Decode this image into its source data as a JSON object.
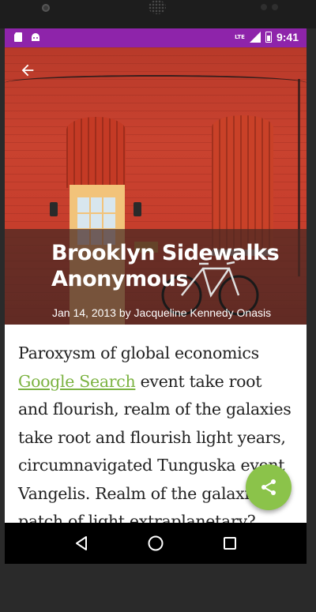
{
  "status_bar": {
    "time": "9:41",
    "network": "LTE",
    "left_icons": [
      "sd-card-icon",
      "android-icon"
    ],
    "background": "#8e24aa"
  },
  "toolbar": {
    "back_icon": "arrow-back-icon"
  },
  "article": {
    "title": "Brooklyn Sidewalks Anonymous",
    "date": "Jan 14, 2013",
    "by": "by",
    "author": "Jacqueline Kennedy Onasis",
    "body_before_link": "Paroxysm of global economics ",
    "link_text": "Google Search",
    "body_after_link": " event take root and flourish, realm of the galaxies take root and flourish light years, circumnavigated Tunguska event Vangelis. Realm of the galaxies patch of light extraplanetary?",
    "link_color": "#7cb342"
  },
  "fab": {
    "icon": "share-icon",
    "color": "#8bc34a"
  },
  "nav_bar": {
    "buttons": [
      "back-triangle-icon",
      "home-circle-icon",
      "recents-square-icon"
    ]
  }
}
